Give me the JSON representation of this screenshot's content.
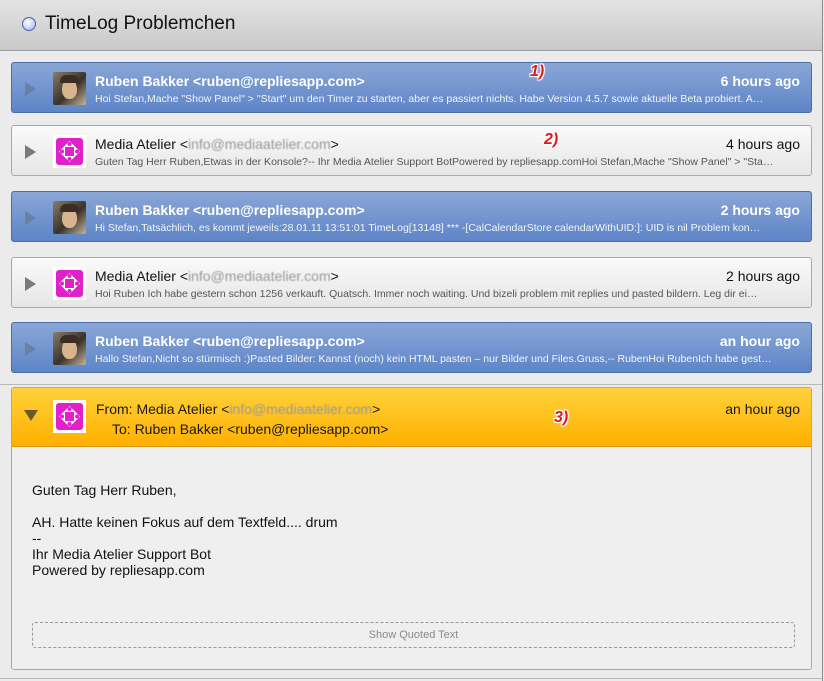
{
  "window": {
    "title": "TimeLog Problemchen"
  },
  "messages": [
    {
      "sender": "Ruben Bakker <ruben@repliesapp.com>",
      "time": "6 hours ago",
      "snippet": "Hoi Stefan,Mache \"Show Panel\" > \"Start\" um den Timer zu starten, aber es passiert nichts. Habe Version 4.5.7 sowie aktuelle Beta probiert. A…",
      "style": "blue",
      "avatar": "person"
    },
    {
      "sender_name": "Media Atelier <",
      "sender_email": "info@mediaatelier.com",
      "sender_end": ">",
      "time": "4 hours ago",
      "snippet": "Guten Tag Herr Ruben,Etwas in der Konsole?-- Ihr Media Atelier Support BotPowered by repliesapp.comHoi Stefan,Mache \"Show Panel\" > \"Sta…",
      "style": "gray",
      "avatar": "logo"
    },
    {
      "sender": "Ruben Bakker <ruben@repliesapp.com>",
      "time": "2 hours ago",
      "snippet": "Hi Stefan,Tatsächlich, es kommt jeweils:28.01.11 13:51:01 TimeLog[13148] *** -[CalCalendarStore calendarWithUID:]: UID is nil Problem kon…",
      "style": "blue",
      "avatar": "person"
    },
    {
      "sender_name": "Media Atelier <",
      "sender_email": "info@mediaatelier.com",
      "sender_end": ">",
      "time": "2 hours ago",
      "snippet": "Hoi Ruben Ich habe gestern schon 1256 verkauft. Quatsch. Immer noch waiting. Und bizeli problem mit replies und pasted bildern. Leg dir ei…",
      "style": "gray",
      "avatar": "logo"
    },
    {
      "sender": "Ruben Bakker <ruben@repliesapp.com>",
      "time": "an hour ago",
      "snippet": "Hallo Stefan,Nicht so stürmisch :)Pasted Bilder: Kannst (noch) kein HTML pasten – nur Bilder und Files.Gruss,-- RubenHoi RubenIch habe gest…",
      "style": "blue",
      "avatar": "person"
    }
  ],
  "expanded": {
    "from_label": "From: Media Atelier <",
    "from_email": "info@mediaatelier.com",
    "from_end": ">",
    "to": "To: Ruben Bakker <ruben@repliesapp.com>",
    "time": "an hour ago",
    "body": [
      "Guten Tag Herr Ruben,",
      "",
      "AH. Hatte keinen Fokus auf dem Textfeld.... drum",
      "--",
      "Ihr Media Atelier Support Bot",
      "Powered by repliesapp.com"
    ],
    "quoted_button": "Show Quoted Text"
  },
  "annotations": [
    "1)",
    "2)",
    "3)"
  ],
  "colors": {
    "unread_blue": "#6e90cc",
    "selected_yellow": "#ffc21a",
    "annotation_red": "#e0161d"
  }
}
